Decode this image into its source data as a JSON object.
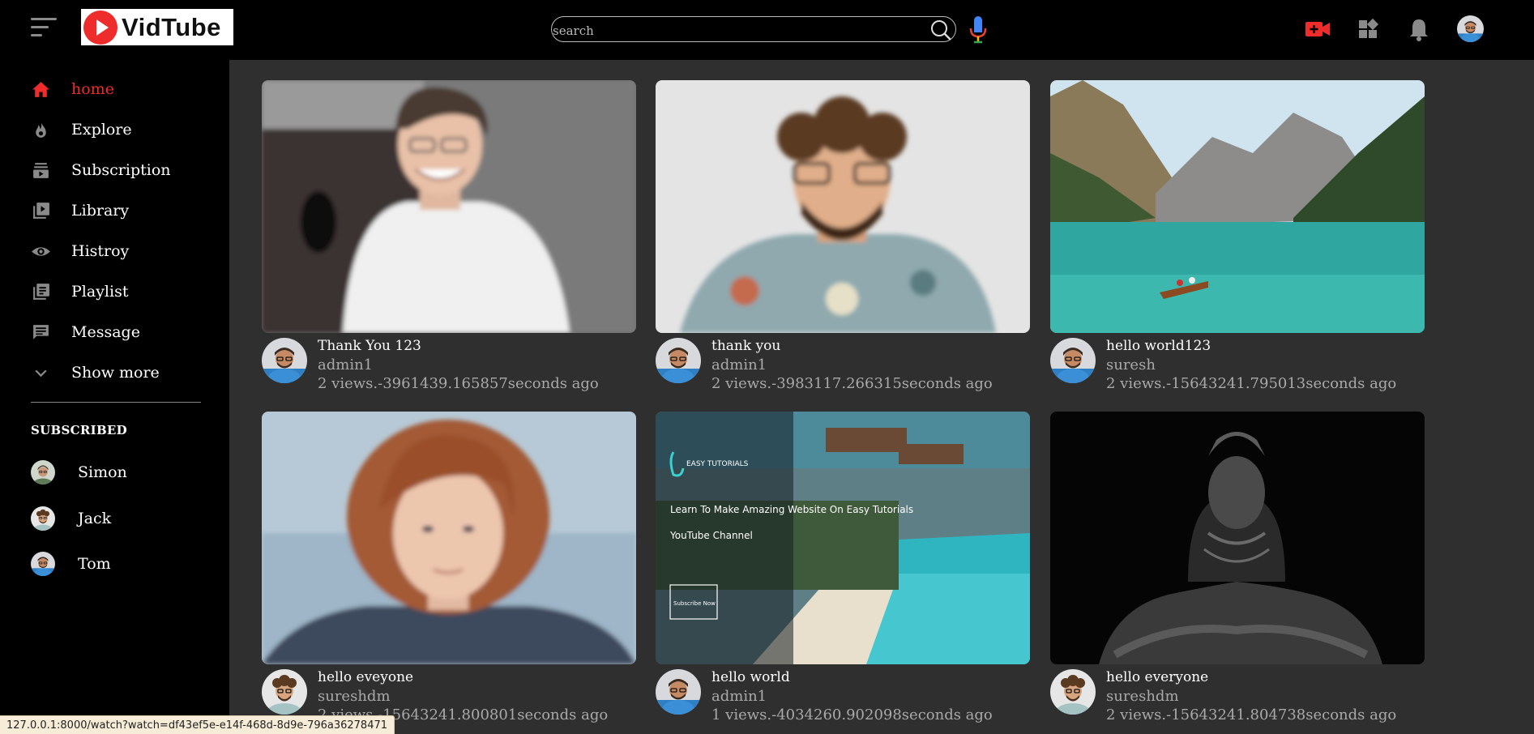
{
  "app": {
    "name": "VidTube"
  },
  "search": {
    "placeholder": "search",
    "value": ""
  },
  "sidebar": {
    "items": [
      {
        "label": "home",
        "icon": "home-icon",
        "active": true
      },
      {
        "label": "Explore",
        "icon": "fire-icon"
      },
      {
        "label": "Subscription",
        "icon": "subscriptions-icon"
      },
      {
        "label": "Library",
        "icon": "library-icon"
      },
      {
        "label": "Histroy",
        "icon": "eye-icon"
      },
      {
        "label": "Playlist",
        "icon": "playlist-icon"
      },
      {
        "label": "Message",
        "icon": "message-icon"
      },
      {
        "label": "Show more",
        "icon": "chevron-down-icon"
      }
    ],
    "subscribed_title": "SUBSCRIBED",
    "subscriptions": [
      {
        "name": "Simon"
      },
      {
        "name": "Jack"
      },
      {
        "name": "Tom"
      }
    ]
  },
  "videos": [
    {
      "title": "Thank You 123",
      "channel": "admin1",
      "meta": "2 views.-3961439.165857seconds ago"
    },
    {
      "title": "thank you",
      "channel": "admin1",
      "meta": "2 views.-3983117.266315seconds ago"
    },
    {
      "title": "hello world123",
      "channel": "suresh",
      "meta": "2 views.-15643241.795013seconds ago"
    },
    {
      "title": "hello eveyone",
      "channel": "sureshdm",
      "meta": "2 views.-15643241.800801seconds ago"
    },
    {
      "title": "hello world",
      "channel": "admin1",
      "meta": "1 views.-4034260.902098seconds ago",
      "thumb_text": {
        "brand": "EASY TUTORIALS",
        "headline": "Learn To Make Amazing Website On Easy Tutorials",
        "sub": "YouTube Channel",
        "cta": "Subscribe Now"
      }
    },
    {
      "title": "hello everyone",
      "channel": "sureshdm",
      "meta": "2 views.-15643241.804738seconds ago"
    }
  ],
  "status_bar": {
    "url": "127.0.0.1:8000/watch?watch=df43ef5e-e14f-468d-8d9e-796a36278471"
  },
  "colors": {
    "accent": "#ee2c2c",
    "header_bg": "#000000",
    "content_bg": "#2f2f2f",
    "muted_text": "#a9a9a9"
  }
}
